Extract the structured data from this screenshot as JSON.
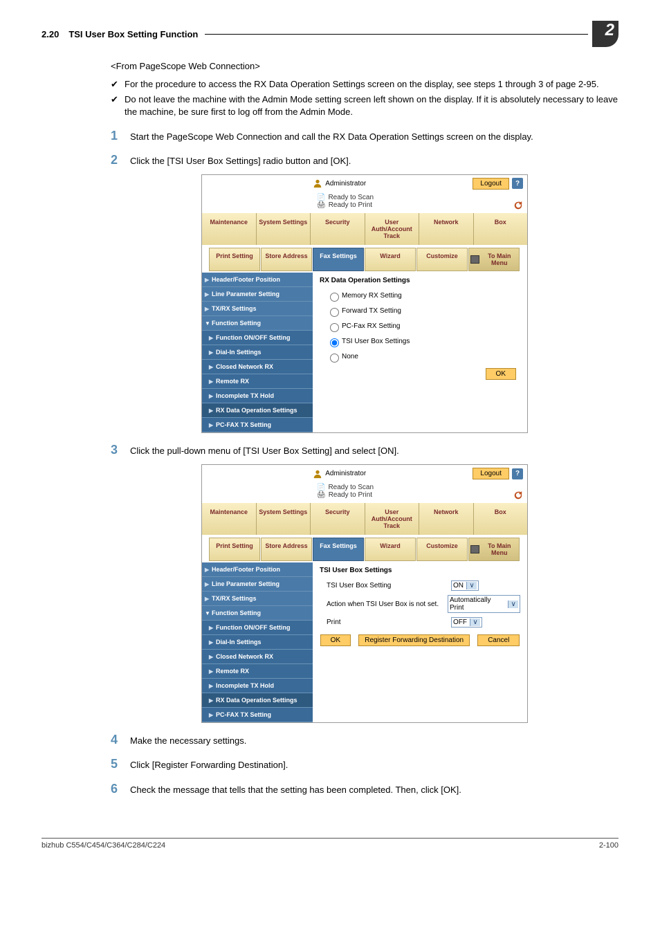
{
  "header": {
    "section_num": "2.20",
    "section_title": "TSI User Box Setting Function",
    "chapter_num": "2"
  },
  "intro": {
    "from": "<From PageScope Web Connection>",
    "check1": "For the procedure to access the RX Data Operation Settings screen on the display, see steps 1 through 3 of page 2-95.",
    "check2": "Do not leave the machine with the Admin Mode setting screen left shown on the display. If it is absolutely necessary to leave the machine, be sure first to log off from the Admin Mode."
  },
  "steps": {
    "s1": "Start the PageScope Web Connection and call the RX Data Operation Settings screen on the display.",
    "s2": "Click the [TSI User Box Settings] radio button and [OK].",
    "s3": "Click the pull-down menu of [TSI User Box Setting] and select [ON].",
    "s4": "Make the necessary settings.",
    "s5": "Click [Register Forwarding Destination].",
    "s6": "Check the message that tells that the setting has been completed. Then, click [OK]."
  },
  "ui": {
    "admin": "Administrator",
    "logout": "Logout",
    "help": "?",
    "ready_scan": "Ready to Scan",
    "ready_print": "Ready to Print",
    "tabs1": [
      "Maintenance",
      "System Settings",
      "Security",
      "User Auth/Account Track",
      "Network",
      "Box"
    ],
    "tabs2": [
      "Print Setting",
      "Store Address",
      "Fax Settings",
      "Wizard",
      "Customize",
      "To Main Menu"
    ],
    "side": {
      "hfp": "Header/Footer Position",
      "lps": "Line Parameter Setting",
      "txrx": "TX/RX Settings",
      "func": "Function Setting",
      "onoff": "Function ON/OFF Setting",
      "dial": "Dial-In Settings",
      "cnrx": "Closed Network RX",
      "rrx": "Remote RX",
      "itxh": "Incomplete TX Hold",
      "rxdata": "RX Data Operation Settings",
      "pcfax": "PC-FAX TX Setting"
    },
    "panel1": {
      "title": "RX Data Operation Settings",
      "r1": "Memory RX Setting",
      "r2": "Forward TX Setting",
      "r3": "PC-Fax RX Setting",
      "r4": "TSI User Box Settings",
      "r5": "None",
      "ok": "OK"
    },
    "panel2": {
      "title": "TSI User Box Settings",
      "row1": "TSI User Box Setting",
      "row1v": "ON",
      "row2": "Action when TSI User Box is not set.",
      "row2v": "Automatically Print",
      "row3": "Print",
      "row3v": "OFF",
      "ok": "OK",
      "reg": "Register Forwarding Destination",
      "cancel": "Cancel"
    }
  },
  "footer": {
    "left": "bizhub C554/C454/C364/C284/C224",
    "right": "2-100"
  }
}
